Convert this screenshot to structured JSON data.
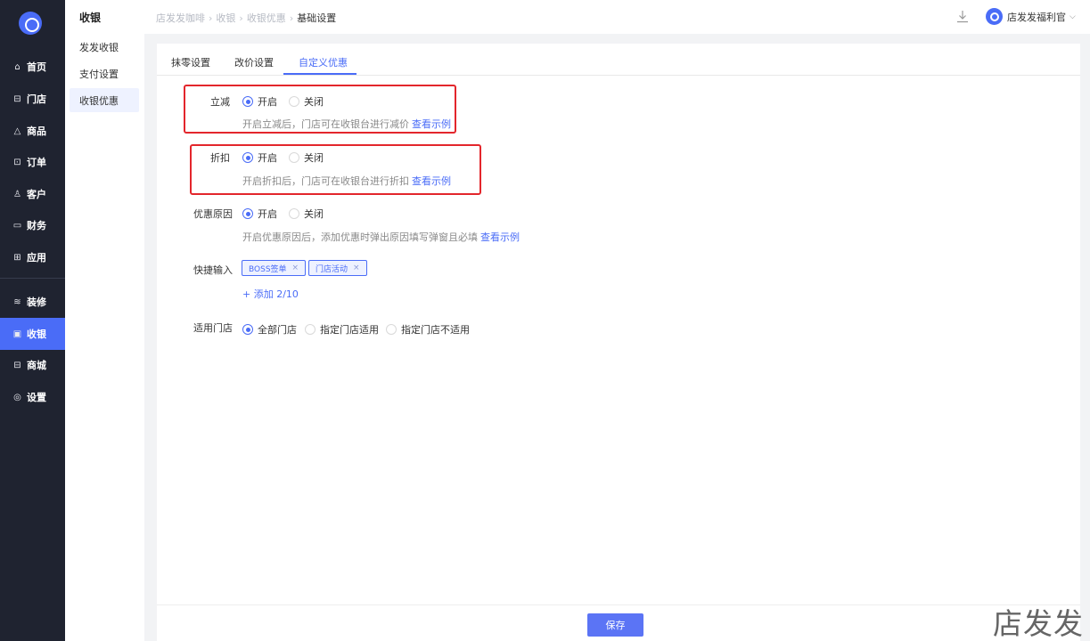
{
  "nav": {
    "items": [
      {
        "icon": "home-icon",
        "glyph": "⌂",
        "label": "首页"
      },
      {
        "icon": "store-icon",
        "glyph": "⊟",
        "label": "门店"
      },
      {
        "icon": "goods-icon",
        "glyph": "△",
        "label": "商品"
      },
      {
        "icon": "order-icon",
        "glyph": "⊡",
        "label": "订单"
      },
      {
        "icon": "customer-icon",
        "glyph": "♙",
        "label": "客户"
      },
      {
        "icon": "finance-icon",
        "glyph": "▭",
        "label": "财务"
      },
      {
        "icon": "apps-icon",
        "glyph": "⊞",
        "label": "应用"
      },
      {
        "icon": "decorate-icon",
        "glyph": "≋",
        "label": "装修"
      },
      {
        "icon": "cashier-icon",
        "glyph": "▣",
        "label": "收银"
      },
      {
        "icon": "mall-icon",
        "glyph": "⊟",
        "label": "商城"
      },
      {
        "icon": "settings-icon",
        "glyph": "◎",
        "label": "设置"
      }
    ],
    "active_index": 8
  },
  "subnav": {
    "title": "收银",
    "items": [
      "发发收银",
      "支付设置",
      "收银优惠"
    ],
    "active_index": 2
  },
  "header": {
    "breadcrumb": [
      "店发发咖啡",
      "收银",
      "收银优惠",
      "基础设置"
    ],
    "breadcrumb_sep": "›",
    "user_name": "店发发福利官"
  },
  "tabs": {
    "items": [
      "抹零设置",
      "改价设置",
      "自定义优惠"
    ],
    "active_index": 2
  },
  "form": {
    "instant_reduce": {
      "label": "立减",
      "options": [
        "开启",
        "关闭"
      ],
      "selected": 0,
      "help": "开启立减后，门店可在收银台进行减价",
      "link": "查看示例"
    },
    "discount": {
      "label": "折扣",
      "options": [
        "开启",
        "关闭"
      ],
      "selected": 0,
      "help": "开启折扣后，门店可在收银台进行折扣",
      "link": "查看示例"
    },
    "reason": {
      "label": "优惠原因",
      "options": [
        "开启",
        "关闭"
      ],
      "selected": 0,
      "help": "开启优惠原因后，添加优惠时弹出原因填写弹窗且必填",
      "link": "查看示例"
    },
    "quick_input": {
      "label": "快捷输入",
      "tags": [
        "BOSS签单",
        "门店活动"
      ],
      "tag_close": "×",
      "add_label": "+ 添加 2/10"
    },
    "stores": {
      "label": "适用门店",
      "options": [
        "全部门店",
        "指定门店适用",
        "指定门店不适用"
      ],
      "selected": 0
    }
  },
  "footer": {
    "save_label": "保存"
  },
  "watermark": "店发发",
  "colors": {
    "primary": "#4a6cf7",
    "nav_bg": "#1f2330",
    "highlight": "#e3262c"
  }
}
